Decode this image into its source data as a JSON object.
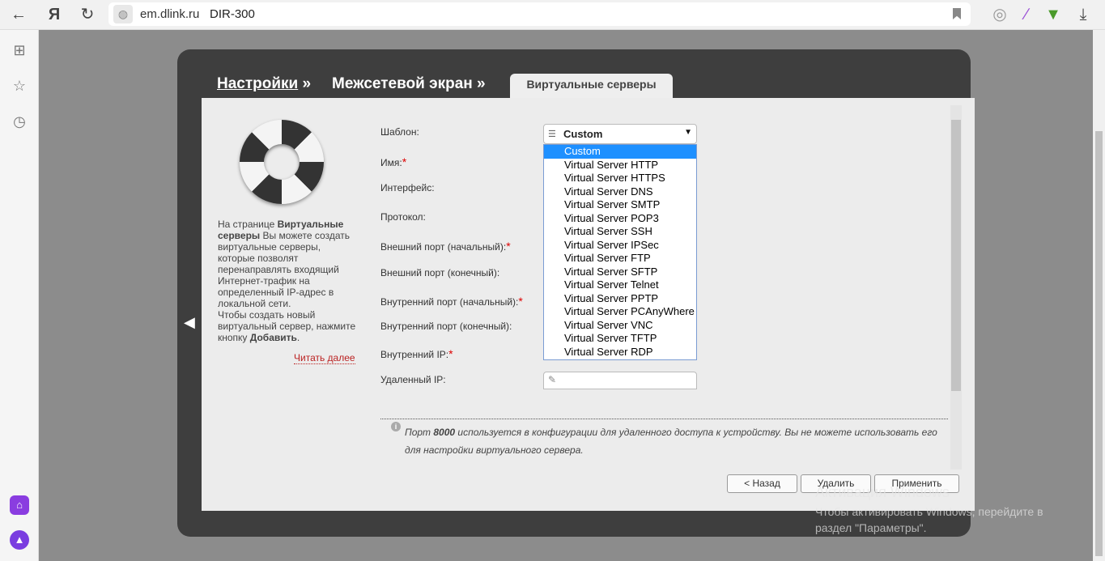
{
  "browser": {
    "url": "em.dlink.ru",
    "page_title": "DIR-300"
  },
  "breadcrumb": {
    "settings": "Настройки",
    "firewall": "Межсетевой экран",
    "sep": "»",
    "tab": "Виртуальные серверы"
  },
  "help": {
    "p1": "На странице ",
    "p1b": "Виртуальные серверы",
    "p2": " Вы можете создать виртуальные серверы, которые позволят перенаправлять входящий Интернет-трафик на определенный IP-адрес в локальной сети.",
    "p3": "Чтобы создать новый виртуальный сервер, нажмите кнопку ",
    "p3b": "Добавить",
    "p3e": ".",
    "more": "Читать далее"
  },
  "form": {
    "template_label": "Шаблон:",
    "name_label": "Имя:",
    "interface_label": "Интерфейс:",
    "protocol_label": "Протокол:",
    "ext_start_label": "Внешний порт (начальный):",
    "ext_end_label": "Внешний порт (конечный):",
    "int_start_label": "Внутренний порт (начальный):",
    "int_end_label": "Внутренний порт (конечный):",
    "int_ip_label": "Внутренний IP:",
    "remote_ip_label": "Удаленный IP:",
    "required_mark": "*",
    "template_value": "Custom"
  },
  "dropdown_options": [
    "Custom",
    "Virtual Server HTTP",
    "Virtual Server HTTPS",
    "Virtual Server DNS",
    "Virtual Server SMTP",
    "Virtual Server POP3",
    "Virtual Server SSH",
    "Virtual Server IPSec",
    "Virtual Server FTP",
    "Virtual Server SFTP",
    "Virtual Server Telnet",
    "Virtual Server PPTP",
    "Virtual Server PCAnyWhere",
    "Virtual Server VNC",
    "Virtual Server TFTP",
    "Virtual Server RDP"
  ],
  "note": {
    "a": "Порт ",
    "b": "8000",
    "c": " используется в конфигурации для удаленного доступа к устройству. Вы не можете использовать его для настройки виртуального сервера."
  },
  "buttons": {
    "back": "< Назад",
    "delete": "Удалить",
    "apply": "Применить"
  },
  "watermark": {
    "title": "Активация Windows",
    "text": "Чтобы активировать Windows, перейдите в раздел \"Параметры\"."
  }
}
